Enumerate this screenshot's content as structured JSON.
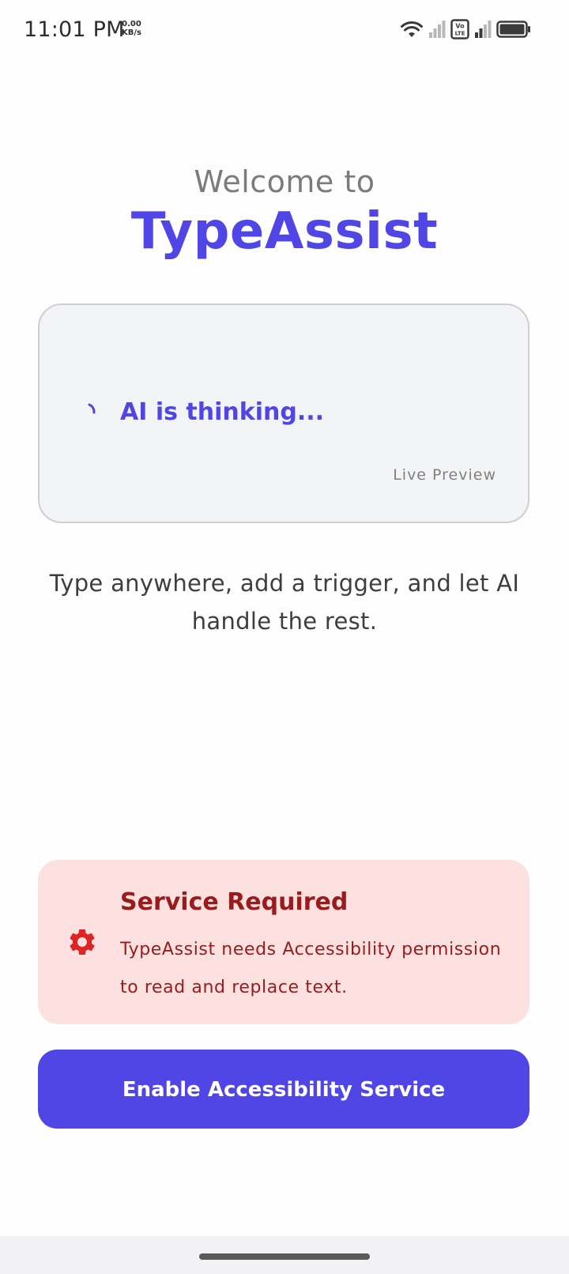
{
  "status_bar": {
    "time": "11:01 PM",
    "net_speed_value": "0.00",
    "net_speed_unit": "KB/s",
    "volte_label": "Vo LTE",
    "icons": [
      "wifi-icon",
      "signal-icon",
      "volte-icon",
      "signal-icon",
      "battery-icon"
    ]
  },
  "welcome": {
    "line1": "Welcome to",
    "brand": "TypeAssist"
  },
  "preview": {
    "status_text": "AI is thinking...",
    "caption": "Live Preview",
    "icon": "spinner-icon"
  },
  "tagline": "Type anywhere, add a trigger, and let AI handle the rest.",
  "service_card": {
    "icon": "gear-icon",
    "title": "Service Required",
    "description": "TypeAssist needs Accessibility permission to read and replace text."
  },
  "enable_button": {
    "label": "Enable Accessibility Service"
  },
  "colors": {
    "brand": "#4f46e5",
    "warning_bg": "#fde1e1",
    "warning_text": "#991b1b",
    "gear": "#dc2626",
    "card_bg": "#f3f4f6"
  }
}
